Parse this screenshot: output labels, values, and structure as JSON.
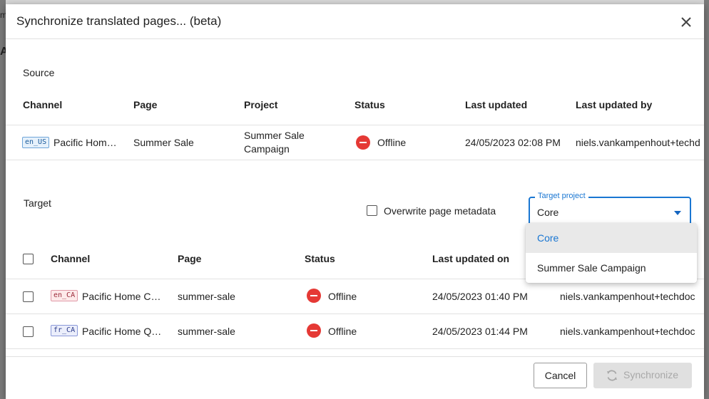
{
  "dialog": {
    "title": "Synchronize translated pages... (beta)"
  },
  "source": {
    "section_label": "Source",
    "columns": [
      "Channel",
      "Page",
      "Project",
      "Status",
      "Last updated",
      "Last updated by"
    ],
    "row": {
      "locale": "en_US",
      "channel": "Pacific Hom…",
      "page": "Summer Sale",
      "project_line1": "Summer Sale",
      "project_line2": "Campaign",
      "status": "Offline",
      "last_updated": "24/05/2023 02:08 PM",
      "last_updated_by": "niels.vankampenhout+techd"
    }
  },
  "target": {
    "section_label": "Target",
    "overwrite_label": "Overwrite page metadata",
    "columns": [
      "Channel",
      "Page",
      "Status",
      "Last updated on"
    ],
    "rows": [
      {
        "locale": "en_CA",
        "channel": "Pacific Home C…",
        "page": "summer-sale",
        "status": "Offline",
        "last_updated": "24/05/2023 01:40 PM",
        "last_updated_by": "niels.vankampenhout+techdoc"
      },
      {
        "locale": "fr_CA",
        "channel": "Pacific Home Q…",
        "page": "summer-sale",
        "status": "Offline",
        "last_updated": "24/05/2023 01:44 PM",
        "last_updated_by": "niels.vankampenhout+techdoc"
      }
    ]
  },
  "target_project": {
    "label": "Target project",
    "value": "Core",
    "options": [
      "Core",
      "Summer Sale Campaign"
    ]
  },
  "footer": {
    "cancel_label": "Cancel",
    "sync_label": "Synchronize"
  },
  "colors": {
    "accent": "#1976d2",
    "offline": "#e53935"
  }
}
